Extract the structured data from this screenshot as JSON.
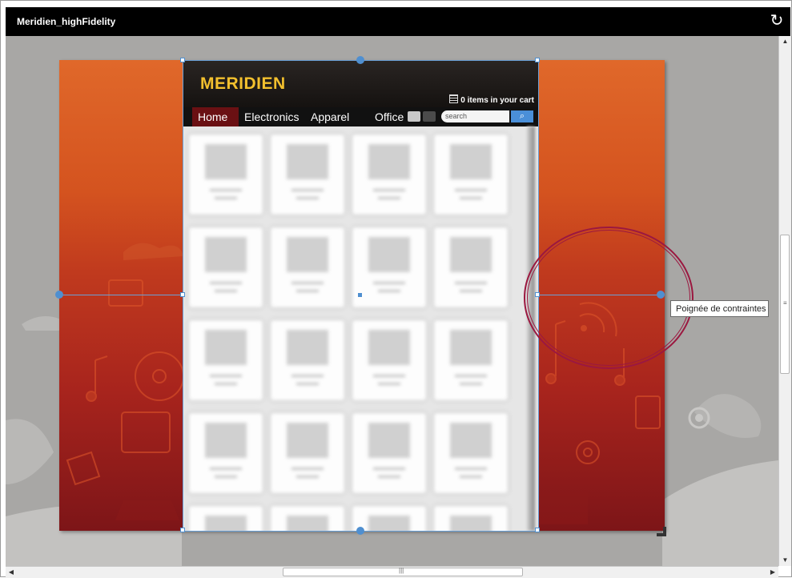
{
  "window": {
    "title": "Meridien_highFidelity",
    "refresh_icon": "refresh-icon"
  },
  "site": {
    "logo": "MERIDIEN",
    "cart_text": "0 items in your cart",
    "nav": [
      "Home",
      "Electronics",
      "Apparel",
      "Office"
    ],
    "active_nav": "Home",
    "search_placeholder": "search",
    "search_icon": "search-icon",
    "view_icons": [
      "grid-view-icon",
      "list-view-icon"
    ]
  },
  "tooltip": "Poignée de contraintes",
  "colors": {
    "titlebar": "#000000",
    "canvas": "#a8a7a5",
    "banner_top": "#e0682a",
    "banner_bottom": "#7d1518",
    "logo": "#f3c02e",
    "nav_active": "#6a1013",
    "selection": "#4f8fd0",
    "highlight_ring": "#9b1840"
  }
}
